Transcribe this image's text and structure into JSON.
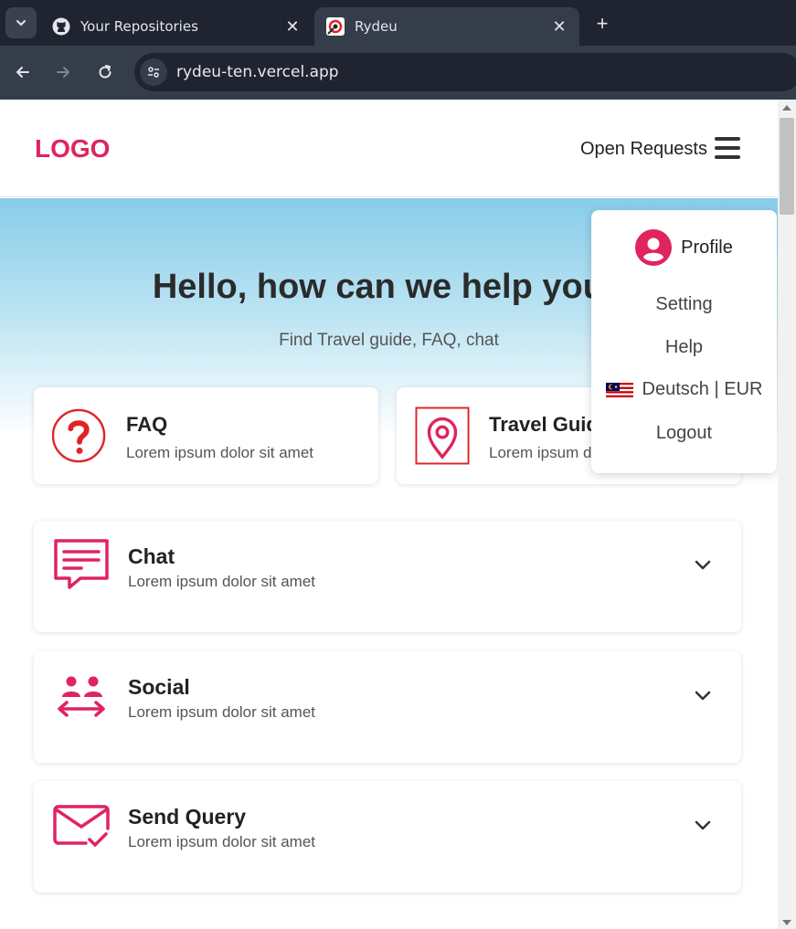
{
  "browser": {
    "tabs": [
      {
        "label": "Your Repositories",
        "icon": "github-icon"
      },
      {
        "label": "Rydeu",
        "icon": "rydeu-favicon"
      }
    ],
    "url": "rydeu-ten.vercel.app"
  },
  "header": {
    "logo": "LOGO",
    "open_requests": "Open Requests"
  },
  "hero": {
    "title": "Hello, how can we help you?",
    "subtitle": "Find Travel guide, FAQ, chat"
  },
  "top_cards": [
    {
      "title": "FAQ",
      "subtitle": "Lorem ipsum dolor sit amet",
      "icon": "question-icon"
    },
    {
      "title": "Travel Guide",
      "subtitle": "Lorem ipsum dolor sit amet",
      "icon": "map-pin-icon"
    }
  ],
  "sections": [
    {
      "title": "Chat",
      "subtitle": "Lorem ipsum dolor sit amet",
      "icon": "chat-icon"
    },
    {
      "title": "Social",
      "subtitle": "Lorem ipsum dolor sit amet",
      "icon": "social-icon"
    },
    {
      "title": "Send Query",
      "subtitle": "Lorem ipsum dolor sit amet",
      "icon": "mail-check-icon"
    }
  ],
  "menu": {
    "profile": "Profile",
    "setting": "Setting",
    "help": "Help",
    "language": "Deutsch | EUR",
    "logout": "Logout"
  },
  "colors": {
    "brand": "#e0245e",
    "accent_red": "#e02424"
  }
}
